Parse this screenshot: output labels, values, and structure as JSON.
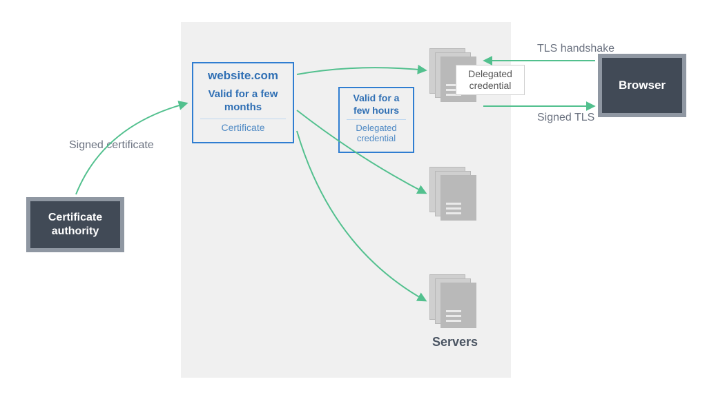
{
  "boxes": {
    "ca": "Certificate authority",
    "browser": "Browser"
  },
  "cert": {
    "domain": "website.com",
    "valid": "Valid for a few months",
    "caption": "Certificate"
  },
  "delegated": {
    "valid": "Valid for a few hours",
    "caption": "Delegated credential"
  },
  "labels": {
    "signed_cert": "Signed certificate",
    "tls_handshake": "TLS handshake",
    "signed_tls": "Signed TLS",
    "servers": "Servers",
    "delegated_credential": "Delegated credential"
  },
  "colors": {
    "arrow": "#52c08e",
    "outline": "#2f7dd1",
    "dark_fill": "#414a56",
    "dark_border": "#8f97a2",
    "panel": "#f0f0f0"
  }
}
